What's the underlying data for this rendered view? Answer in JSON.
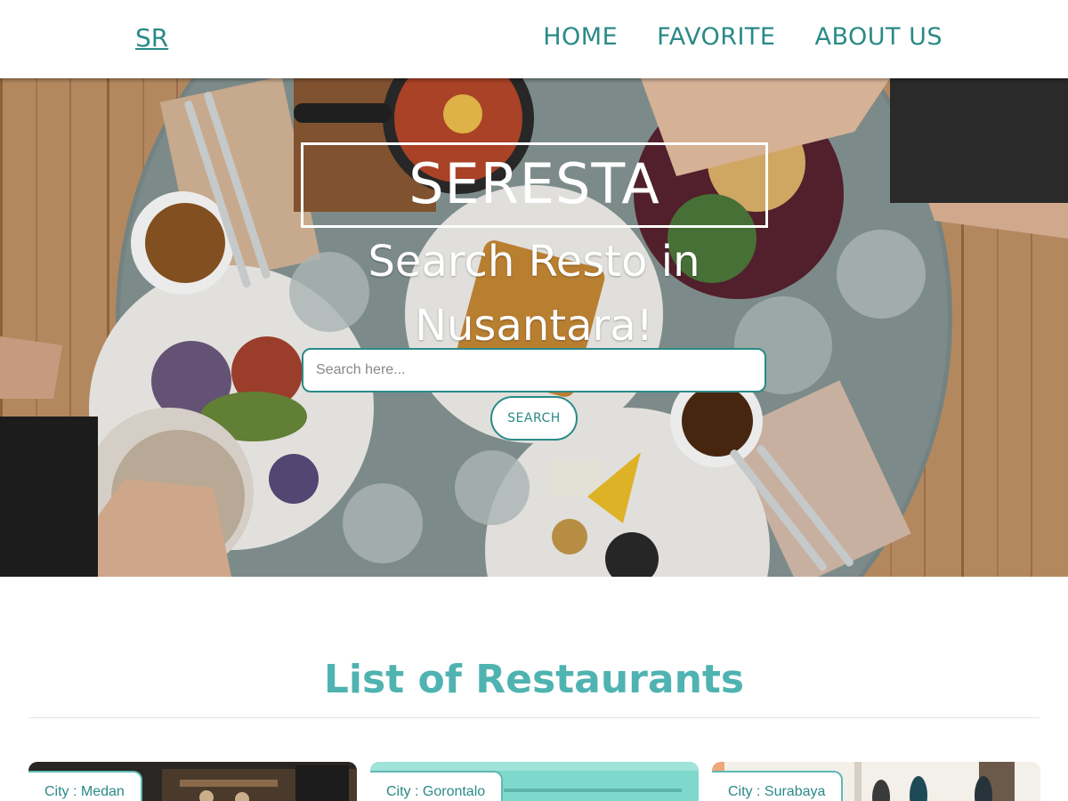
{
  "header": {
    "logo": "SR",
    "nav": [
      {
        "label": "HOME"
      },
      {
        "label": "FAVORITE"
      },
      {
        "label": "ABOUT US"
      }
    ]
  },
  "hero": {
    "title": "SERESTA",
    "subtitle": "Search Resto in Nusantara!",
    "search": {
      "placeholder": "Search here...",
      "value": ""
    },
    "search_button": "SEARCH"
  },
  "restaurants": {
    "heading": "List of Restaurants",
    "cards": [
      {
        "city": "City : Medan"
      },
      {
        "city": "City : Gorontalo"
      },
      {
        "city": "City : Surabaya"
      }
    ]
  },
  "colors": {
    "accent": "#2a8a87",
    "heading": "#4fb3b1",
    "border": "#5fb9b4"
  }
}
